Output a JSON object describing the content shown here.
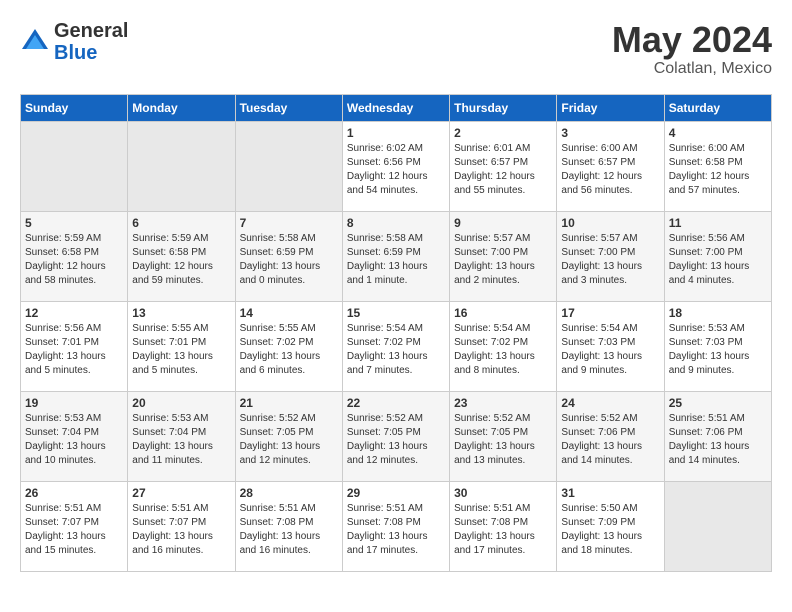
{
  "header": {
    "logo_general": "General",
    "logo_blue": "Blue",
    "month_year": "May 2024",
    "location": "Colatlan, Mexico"
  },
  "days_of_week": [
    "Sunday",
    "Monday",
    "Tuesday",
    "Wednesday",
    "Thursday",
    "Friday",
    "Saturday"
  ],
  "weeks": [
    [
      {
        "day": "",
        "info": ""
      },
      {
        "day": "",
        "info": ""
      },
      {
        "day": "",
        "info": ""
      },
      {
        "day": "1",
        "info": "Sunrise: 6:02 AM\nSunset: 6:56 PM\nDaylight: 12 hours\nand 54 minutes."
      },
      {
        "day": "2",
        "info": "Sunrise: 6:01 AM\nSunset: 6:57 PM\nDaylight: 12 hours\nand 55 minutes."
      },
      {
        "day": "3",
        "info": "Sunrise: 6:00 AM\nSunset: 6:57 PM\nDaylight: 12 hours\nand 56 minutes."
      },
      {
        "day": "4",
        "info": "Sunrise: 6:00 AM\nSunset: 6:58 PM\nDaylight: 12 hours\nand 57 minutes."
      }
    ],
    [
      {
        "day": "5",
        "info": "Sunrise: 5:59 AM\nSunset: 6:58 PM\nDaylight: 12 hours\nand 58 minutes."
      },
      {
        "day": "6",
        "info": "Sunrise: 5:59 AM\nSunset: 6:58 PM\nDaylight: 12 hours\nand 59 minutes."
      },
      {
        "day": "7",
        "info": "Sunrise: 5:58 AM\nSunset: 6:59 PM\nDaylight: 13 hours\nand 0 minutes."
      },
      {
        "day": "8",
        "info": "Sunrise: 5:58 AM\nSunset: 6:59 PM\nDaylight: 13 hours\nand 1 minute."
      },
      {
        "day": "9",
        "info": "Sunrise: 5:57 AM\nSunset: 7:00 PM\nDaylight: 13 hours\nand 2 minutes."
      },
      {
        "day": "10",
        "info": "Sunrise: 5:57 AM\nSunset: 7:00 PM\nDaylight: 13 hours\nand 3 minutes."
      },
      {
        "day": "11",
        "info": "Sunrise: 5:56 AM\nSunset: 7:00 PM\nDaylight: 13 hours\nand 4 minutes."
      }
    ],
    [
      {
        "day": "12",
        "info": "Sunrise: 5:56 AM\nSunset: 7:01 PM\nDaylight: 13 hours\nand 5 minutes."
      },
      {
        "day": "13",
        "info": "Sunrise: 5:55 AM\nSunset: 7:01 PM\nDaylight: 13 hours\nand 5 minutes."
      },
      {
        "day": "14",
        "info": "Sunrise: 5:55 AM\nSunset: 7:02 PM\nDaylight: 13 hours\nand 6 minutes."
      },
      {
        "day": "15",
        "info": "Sunrise: 5:54 AM\nSunset: 7:02 PM\nDaylight: 13 hours\nand 7 minutes."
      },
      {
        "day": "16",
        "info": "Sunrise: 5:54 AM\nSunset: 7:02 PM\nDaylight: 13 hours\nand 8 minutes."
      },
      {
        "day": "17",
        "info": "Sunrise: 5:54 AM\nSunset: 7:03 PM\nDaylight: 13 hours\nand 9 minutes."
      },
      {
        "day": "18",
        "info": "Sunrise: 5:53 AM\nSunset: 7:03 PM\nDaylight: 13 hours\nand 9 minutes."
      }
    ],
    [
      {
        "day": "19",
        "info": "Sunrise: 5:53 AM\nSunset: 7:04 PM\nDaylight: 13 hours\nand 10 minutes."
      },
      {
        "day": "20",
        "info": "Sunrise: 5:53 AM\nSunset: 7:04 PM\nDaylight: 13 hours\nand 11 minutes."
      },
      {
        "day": "21",
        "info": "Sunrise: 5:52 AM\nSunset: 7:05 PM\nDaylight: 13 hours\nand 12 minutes."
      },
      {
        "day": "22",
        "info": "Sunrise: 5:52 AM\nSunset: 7:05 PM\nDaylight: 13 hours\nand 12 minutes."
      },
      {
        "day": "23",
        "info": "Sunrise: 5:52 AM\nSunset: 7:05 PM\nDaylight: 13 hours\nand 13 minutes."
      },
      {
        "day": "24",
        "info": "Sunrise: 5:52 AM\nSunset: 7:06 PM\nDaylight: 13 hours\nand 14 minutes."
      },
      {
        "day": "25",
        "info": "Sunrise: 5:51 AM\nSunset: 7:06 PM\nDaylight: 13 hours\nand 14 minutes."
      }
    ],
    [
      {
        "day": "26",
        "info": "Sunrise: 5:51 AM\nSunset: 7:07 PM\nDaylight: 13 hours\nand 15 minutes."
      },
      {
        "day": "27",
        "info": "Sunrise: 5:51 AM\nSunset: 7:07 PM\nDaylight: 13 hours\nand 16 minutes."
      },
      {
        "day": "28",
        "info": "Sunrise: 5:51 AM\nSunset: 7:08 PM\nDaylight: 13 hours\nand 16 minutes."
      },
      {
        "day": "29",
        "info": "Sunrise: 5:51 AM\nSunset: 7:08 PM\nDaylight: 13 hours\nand 17 minutes."
      },
      {
        "day": "30",
        "info": "Sunrise: 5:51 AM\nSunset: 7:08 PM\nDaylight: 13 hours\nand 17 minutes."
      },
      {
        "day": "31",
        "info": "Sunrise: 5:50 AM\nSunset: 7:09 PM\nDaylight: 13 hours\nand 18 minutes."
      },
      {
        "day": "",
        "info": ""
      }
    ]
  ]
}
